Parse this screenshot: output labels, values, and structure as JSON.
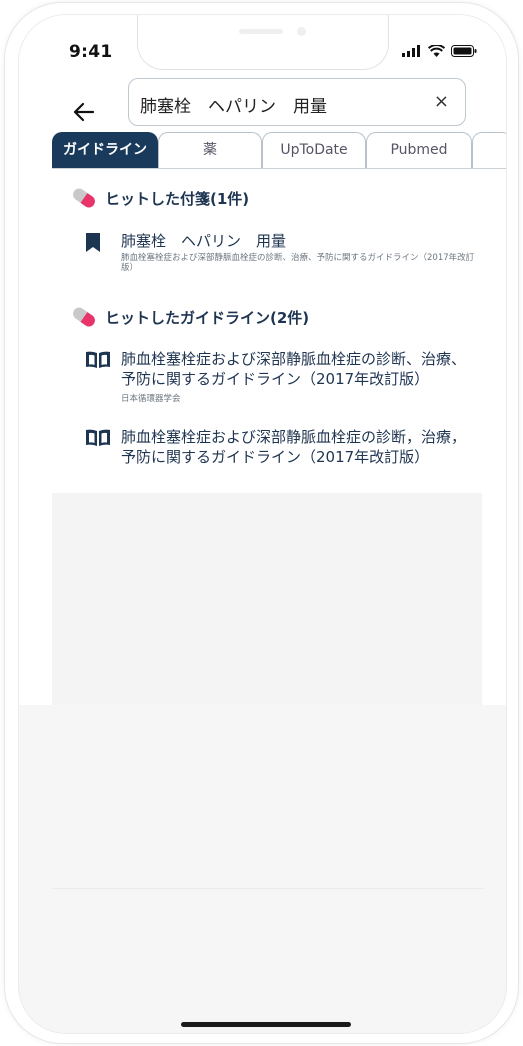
{
  "status_bar": {
    "time": "9:41"
  },
  "search": {
    "query": "肺塞栓　ヘパリン　用量",
    "clear_label": "×"
  },
  "tabs": [
    {
      "label": "ガイドライン",
      "active": true
    },
    {
      "label": "薬",
      "active": false
    },
    {
      "label": "UpToDate",
      "active": false
    },
    {
      "label": "Pubmed",
      "active": false
    }
  ],
  "sections": {
    "sticky": {
      "title": "ヒットした付箋(1件)",
      "items": [
        {
          "title": "肺塞栓　ヘパリン　用量",
          "sub": "肺血栓塞栓症および深部静脈血栓症の診断、治療、予防に関するガイドライン（2017年改訂版）",
          "icon": "bookmark-icon"
        }
      ]
    },
    "guidelines": {
      "title": "ヒットしたガイドライン(2件)",
      "items": [
        {
          "title": "肺血栓塞栓症および深部静脈血栓症の診断、治療、予防に関するガイドライン（2017年改訂版）",
          "sub": "日本循環器学会",
          "icon": "book-icon"
        },
        {
          "title": "肺血栓塞栓症および深部静脈血栓症の診断，治療，予防に関するガイドライン（2017年改訂版）",
          "sub": "",
          "icon": "book-icon"
        }
      ]
    }
  },
  "colors": {
    "accent": "#1a3a5c",
    "pill_pink": "#e8336b",
    "pill_gray": "#c9c9c9"
  }
}
